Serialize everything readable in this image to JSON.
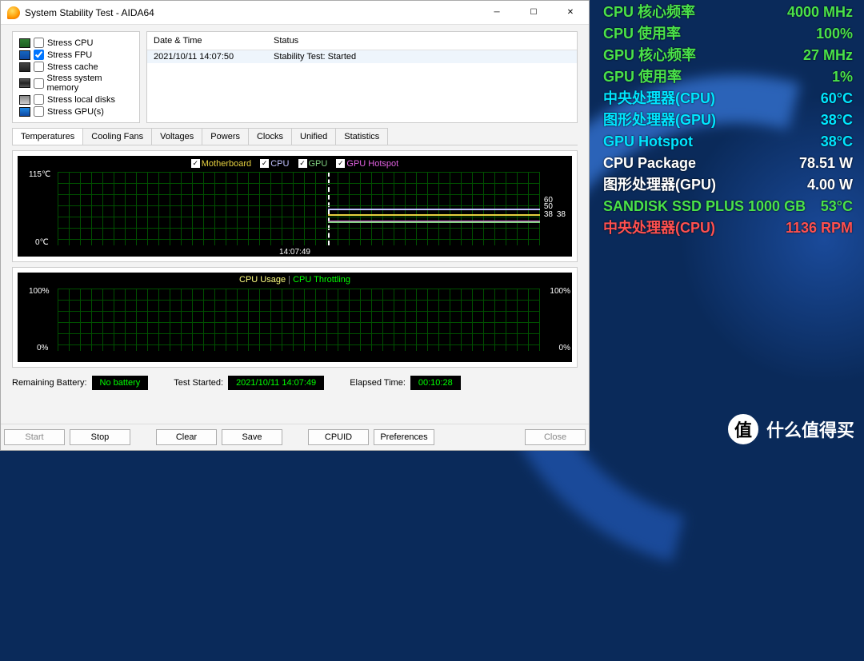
{
  "window": {
    "title": "System Stability Test - AIDA64",
    "stress_options": [
      {
        "label": "Stress CPU",
        "checked": false
      },
      {
        "label": "Stress FPU",
        "checked": true
      },
      {
        "label": "Stress cache",
        "checked": false
      },
      {
        "label": "Stress system memory",
        "checked": false
      },
      {
        "label": "Stress local disks",
        "checked": false
      },
      {
        "label": "Stress GPU(s)",
        "checked": false
      }
    ],
    "log": {
      "headers": {
        "datetime": "Date & Time",
        "status": "Status"
      },
      "row": {
        "datetime": "2021/10/11 14:07:50",
        "status": "Stability Test: Started"
      }
    },
    "tabs": [
      "Temperatures",
      "Cooling Fans",
      "Voltages",
      "Powers",
      "Clocks",
      "Unified",
      "Statistics"
    ],
    "temp_graph": {
      "legend": {
        "motherboard": "Motherboard",
        "cpu": "CPU",
        "gpu": "GPU",
        "hotspot": "GPU Hotspot"
      },
      "y_top": "115℃",
      "y_bot": "0℃",
      "x_marker": "14:07:49",
      "right_values": {
        "cpu": "60",
        "mbo": "50",
        "gpu": "38",
        "hot": "38"
      }
    },
    "usage_graph": {
      "legend": {
        "usage": "CPU Usage",
        "throttling": "CPU Throttling"
      },
      "y_top": "100%",
      "y_bot": "0%",
      "r_top": "100%",
      "r_bot": "0%"
    },
    "status": {
      "battery_label": "Remaining Battery:",
      "battery_val": "No battery",
      "started_label": "Test Started:",
      "started_val": "2021/10/11 14:07:49",
      "elapsed_label": "Elapsed Time:",
      "elapsed_val": "00:10:28"
    },
    "buttons": {
      "start": "Start",
      "stop": "Stop",
      "clear": "Clear",
      "save": "Save",
      "cpuid": "CPUID",
      "prefs": "Preferences",
      "close": "Close"
    }
  },
  "overlay": {
    "rows": [
      {
        "label": "CPU 核心频率",
        "value": "4000 MHz",
        "color": "c-lime"
      },
      {
        "label": "CPU 使用率",
        "value": "100%",
        "color": "c-lime"
      },
      {
        "label": "GPU 核心频率",
        "value": "27 MHz",
        "color": "c-lime"
      },
      {
        "label": "GPU 使用率",
        "value": "1%",
        "color": "c-lime"
      },
      {
        "label": "中央处理器(CPU)",
        "value": "60°C",
        "color": "c-cyan"
      },
      {
        "label": "图形处理器(GPU)",
        "value": "38°C",
        "color": "c-cyan"
      },
      {
        "label": "GPU Hotspot",
        "value": "38°C",
        "color": "c-cyan"
      },
      {
        "label": "CPU Package",
        "value": "78.51 W",
        "color": "c-white"
      },
      {
        "label": "图形处理器(GPU)",
        "value": "4.00 W",
        "color": "c-white"
      },
      {
        "label": "SANDISK SSD PLUS 1000 GB",
        "value": "53°C",
        "color": "c-lime"
      },
      {
        "label": "中央处理器(CPU)",
        "value": "1136 RPM",
        "color": "c-red"
      }
    ]
  },
  "watermark": {
    "badge": "值",
    "text": "什么值得买"
  },
  "chart_data": [
    {
      "type": "line",
      "title": "Temperatures",
      "ylabel": "°C",
      "ylim": [
        0,
        115
      ],
      "x_marker": "14:07:49",
      "series": [
        {
          "name": "Motherboard",
          "end_value": 50,
          "color": "#e6d040"
        },
        {
          "name": "CPU",
          "end_value": 60,
          "color": "#c0c0ff"
        },
        {
          "name": "GPU",
          "end_value": 38,
          "color": "#80d080"
        },
        {
          "name": "GPU Hotspot",
          "end_value": 38,
          "color": "#e060e0"
        }
      ]
    },
    {
      "type": "line",
      "title": "CPU Usage / Throttling",
      "ylabel": "%",
      "ylim": [
        0,
        100
      ],
      "series": [
        {
          "name": "CPU Usage",
          "end_value": 0,
          "color": "#ffff80"
        },
        {
          "name": "CPU Throttling",
          "end_value": 0,
          "color": "#00ff00"
        }
      ]
    }
  ]
}
